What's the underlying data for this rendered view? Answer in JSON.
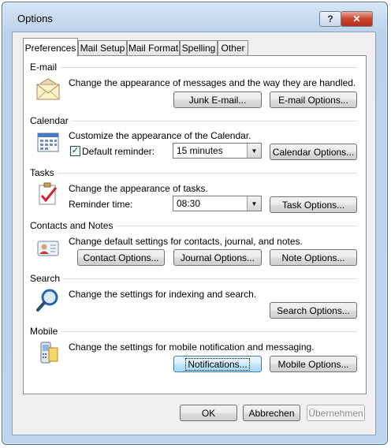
{
  "window": {
    "title": "Options",
    "help": "?",
    "close": "✕"
  },
  "tabs": [
    "Preferences",
    "Mail Setup",
    "Mail Format",
    "Spelling",
    "Other"
  ],
  "email": {
    "title": "E-mail",
    "description": "Change the appearance of messages and the way they are handled.",
    "junk_button": "Junk E-mail...",
    "options_button": "E-mail Options..."
  },
  "calendar": {
    "title": "Calendar",
    "description": "Customize the appearance of the Calendar.",
    "reminder_label": "Default reminder:",
    "reminder_value": "15 minutes",
    "options_button": "Calendar Options..."
  },
  "tasks": {
    "title": "Tasks",
    "description": "Change the appearance of tasks.",
    "reminder_label": "Reminder time:",
    "reminder_value": "08:30",
    "options_button": "Task Options..."
  },
  "contacts": {
    "title": "Contacts and Notes",
    "description": "Change default settings for contacts, journal, and notes.",
    "contact_button": "Contact Options...",
    "journal_button": "Journal Options...",
    "note_button": "Note Options..."
  },
  "search": {
    "title": "Search",
    "description": "Change the settings for indexing and search.",
    "options_button": "Search Options..."
  },
  "mobile": {
    "title": "Mobile",
    "description": "Change the settings for mobile notification and messaging.",
    "notifications_button": "Notifications...",
    "options_button": "Mobile Options..."
  },
  "footer": {
    "ok": "OK",
    "cancel": "Abbrechen",
    "apply": "Übernehmen"
  }
}
